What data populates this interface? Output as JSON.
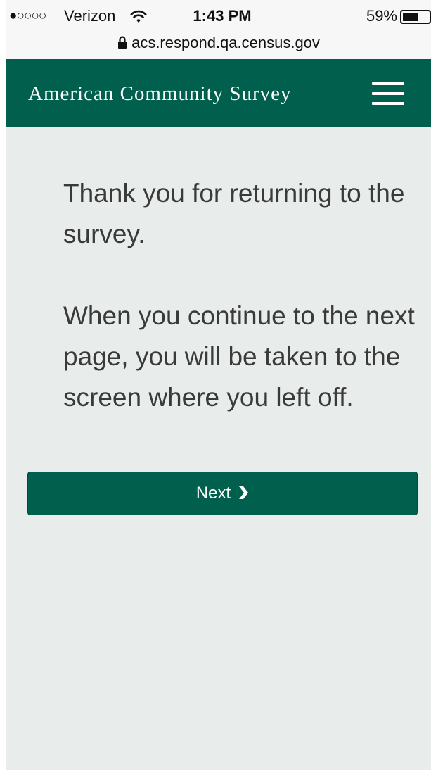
{
  "status_bar": {
    "signal": "●○○○○",
    "carrier": "Verizon",
    "time": "1:43 PM",
    "battery_percent": "59%",
    "battery_level": 0.59,
    "url": "acs.respond.qa.census.gov",
    "icons": [
      "wifi-icon",
      "battery-icon",
      "lock-icon"
    ]
  },
  "header": {
    "title": "American Community Survey",
    "menu_icon": "hamburger-menu-icon",
    "background": "#005f4d"
  },
  "main": {
    "paragraph_1": "Thank you for returning to the survey.",
    "paragraph_2": "When you continue to the next page, you will be taken to the screen where you left off.",
    "next_button": {
      "label": "Next",
      "icon": "chevron-right-icon"
    },
    "background": "#e8eceb"
  }
}
